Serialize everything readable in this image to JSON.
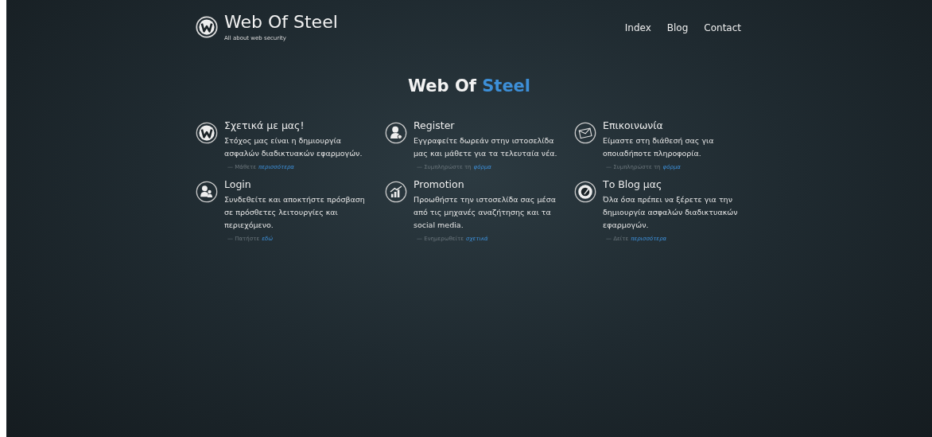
{
  "header": {
    "logo_title": "Web Of Steel",
    "tagline": "All about web security",
    "nav": [
      {
        "label": "Index"
      },
      {
        "label": "Blog"
      },
      {
        "label": "Contact"
      }
    ]
  },
  "hero": {
    "title_part_1": "Web Of",
    "title_part_2": "Steel"
  },
  "features": [
    {
      "kind": "logo",
      "title": "Σχετικά με μας!",
      "text": "Στόχος μας είναι η δημιουργία ασφαλών διαδικτυακών εφαρμογών.",
      "more_text": "— Μάθετε",
      "more_link": "περισσότερα"
    },
    {
      "kind": "register",
      "title": "Register",
      "text": "Εγγραφείτε δωρεάν στην ιστοσελίδα μας και μάθετε για τα τελευταία νέα.",
      "more_text": "— Συμπληρώστε τη",
      "more_link": "φόρμα"
    },
    {
      "kind": "contact",
      "title": "Επικοινωνία",
      "text": "Είμαστε στη διάθεσή σας για οποιαδήποτε πληροφορία.",
      "more_text": "— Συμπληρώστε τη",
      "more_link": "φόρμα"
    },
    {
      "kind": "login",
      "title": "Login",
      "text": "Συνδεθείτε και αποκτήστε πρόσβαση σε πρόσθετες λειτουργίες και περιεχόμενο.",
      "more_text": "— Πατήστε",
      "more_link": "εδώ"
    },
    {
      "kind": "promotion",
      "title": "Promotion",
      "text": "Προωθήστε την ιστοσελίδα σας μέσα από τις μηχανές αναζήτησης και τα social media.",
      "more_text": "— Ενημερωθείτε",
      "more_link": "σχετικά"
    },
    {
      "kind": "blog",
      "title": "Το Blog μας",
      "text": "Όλα όσα πρέπει να ξέρετε για την δημιουργία ασφαλών διαδικτυακών εφαρμογών.",
      "more_text": "— Δείτε",
      "more_link": "περισσότερα"
    }
  ]
}
